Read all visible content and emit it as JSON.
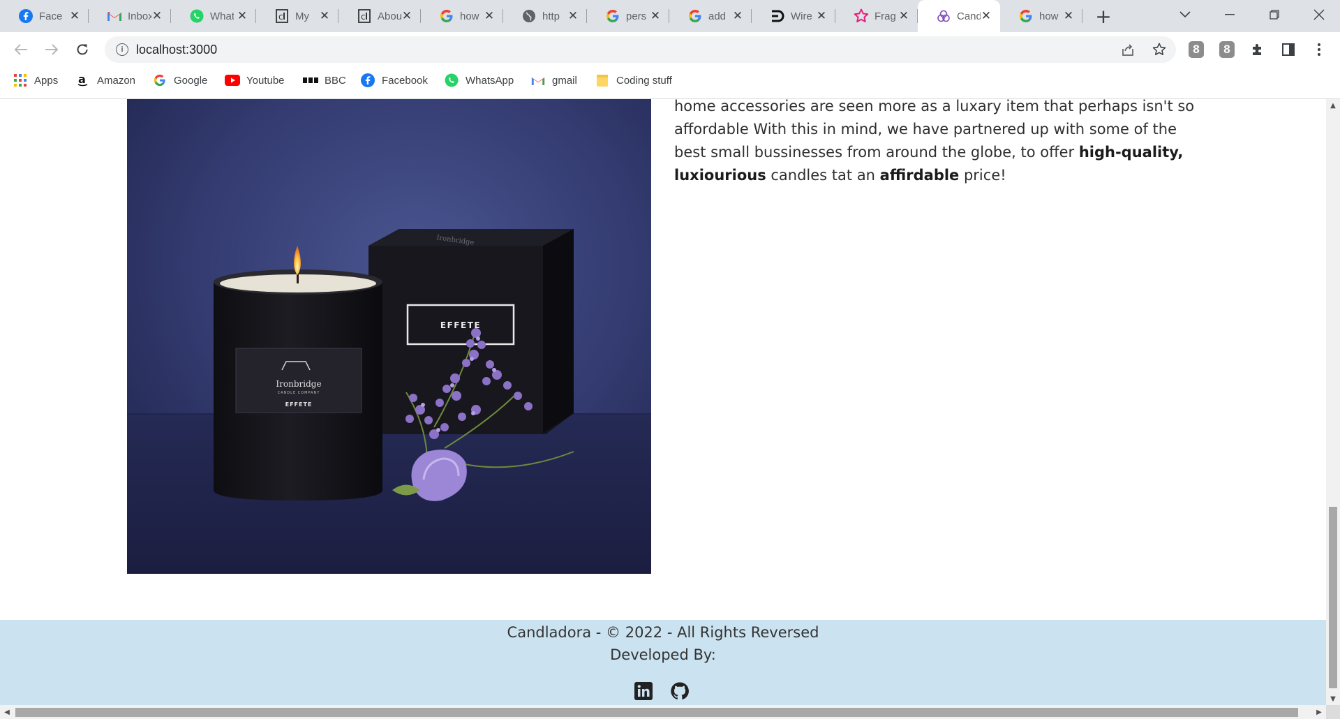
{
  "browser": {
    "tabs": [
      {
        "label": "Facebook",
        "icon": "facebook-icon"
      },
      {
        "label": "Inbox",
        "icon": "gmail-icon"
      },
      {
        "label": "WhatsApp",
        "icon": "whatsapp-icon"
      },
      {
        "label": "My",
        "icon": "document-icon"
      },
      {
        "label": "About",
        "icon": "document-icon"
      },
      {
        "label": "how",
        "icon": "google-icon"
      },
      {
        "label": "http",
        "icon": "globe-icon"
      },
      {
        "label": "pers",
        "icon": "google-icon"
      },
      {
        "label": "add",
        "icon": "google-icon"
      },
      {
        "label": "Wire",
        "icon": "wireframe-icon"
      },
      {
        "label": "Frag",
        "icon": "star-icon"
      },
      {
        "label": "Cand",
        "icon": "candle-site-icon",
        "active": true
      },
      {
        "label": "how",
        "icon": "google-icon"
      }
    ],
    "url": "localhost:3000",
    "extension_badges": [
      "8",
      "8"
    ]
  },
  "bookmarks": [
    {
      "label": "Apps",
      "icon": "apps-grid-icon"
    },
    {
      "label": "Amazon",
      "icon": "amazon-icon"
    },
    {
      "label": "Google",
      "icon": "google-icon"
    },
    {
      "label": "Youtube",
      "icon": "youtube-icon"
    },
    {
      "label": "BBC",
      "icon": "bbc-icon"
    },
    {
      "label": "Facebook",
      "icon": "facebook-icon"
    },
    {
      "label": "WhatsApp",
      "icon": "whatsapp-icon"
    },
    {
      "label": "gmail",
      "icon": "gmail-icon"
    },
    {
      "label": "Coding stuff",
      "icon": "folder-icon"
    }
  ],
  "about": {
    "text_1": "home accessories are seen more as a luxary item that perhaps isn't so affordable With this in mind, we have partnered up with some of the best small bussinesses from around the globe, to offer ",
    "bold_1": "high-quality, luxiourious",
    "text_2": " candles tat an ",
    "bold_2": "affirdable",
    "text_3": " price!",
    "image": {
      "candle_label_brand": "Ironbridge",
      "candle_label_sub": "CANDLE COMPANY",
      "candle_label_name": "EFFETE",
      "box_label": "EFFETE",
      "box_brand": "Ironbridge"
    }
  },
  "footer": {
    "line1": "Candladora - © 2022 - All Rights Reversed",
    "line2": "Developed By:"
  },
  "colors": {
    "footer_bg": "#cbe3f1",
    "tabstrip_bg": "#dee1e6",
    "photo_bg": "#2e3466"
  }
}
